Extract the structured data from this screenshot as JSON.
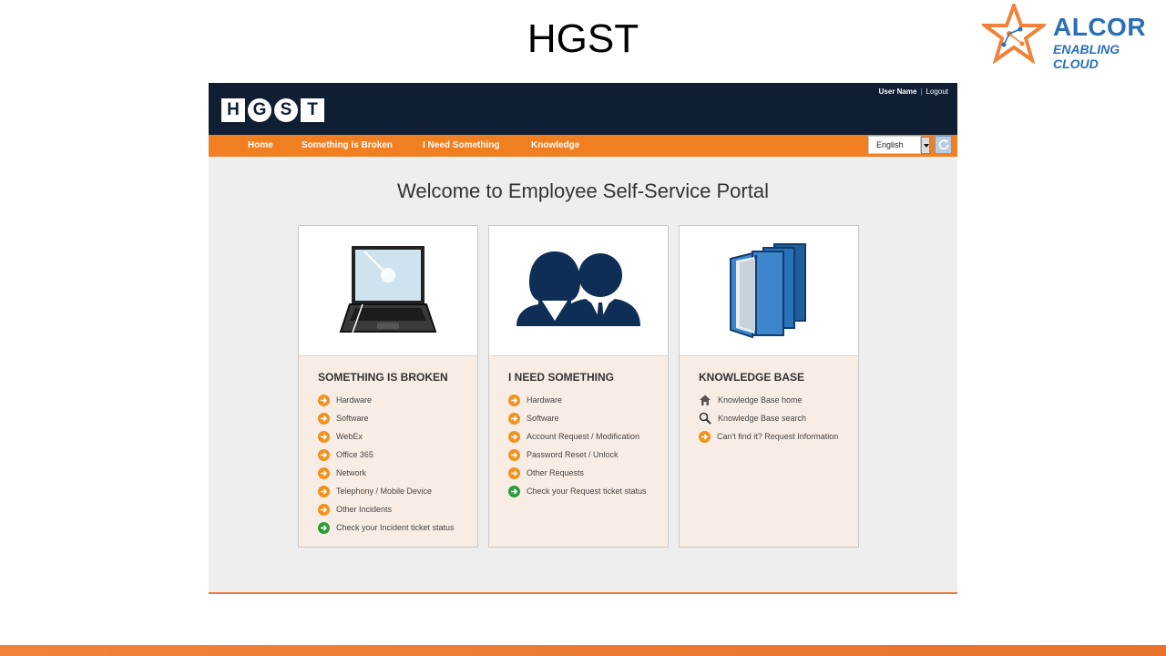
{
  "slide": {
    "title": "HGST"
  },
  "brand": {
    "name": "ALCOR",
    "tagline": "ENABLING CLOUD"
  },
  "portal": {
    "logo_letters": [
      "H",
      "G",
      "S",
      "T"
    ],
    "user": {
      "name": "User Name",
      "separator": "|",
      "logout": "Logout"
    },
    "nav": [
      "Home",
      "Something is Broken",
      "I Need Something",
      "Knowledge"
    ],
    "language": "English",
    "welcome": "Welcome to Employee Self-Service Portal",
    "cards": [
      {
        "title": "SOMETHING IS BROKEN",
        "image": "broken-laptop-icon",
        "items": [
          "Hardware",
          "Software",
          "WebEx",
          "Office 365",
          "Network",
          "Telephony / Mobile Device",
          "Other Incidents",
          "Check your Incident ticket status"
        ]
      },
      {
        "title": "I NEED SOMETHING",
        "image": "people-icon",
        "items": [
          "Hardware",
          "Software",
          "Account Request / Modification",
          "Password Reset / Unlock",
          "Other Requests",
          "Check your Request ticket status"
        ]
      },
      {
        "title": "KNOWLEDGE BASE",
        "image": "books-icon",
        "items": [
          "Knowledge Base home",
          "Knowledge Base search",
          "Can't find it? Request Information"
        ]
      }
    ]
  },
  "colors": {
    "orange": "#f07f22",
    "navy": "#0f1e33",
    "green": "#2f9c3a",
    "alcor_blue": "#2a6fb6"
  }
}
